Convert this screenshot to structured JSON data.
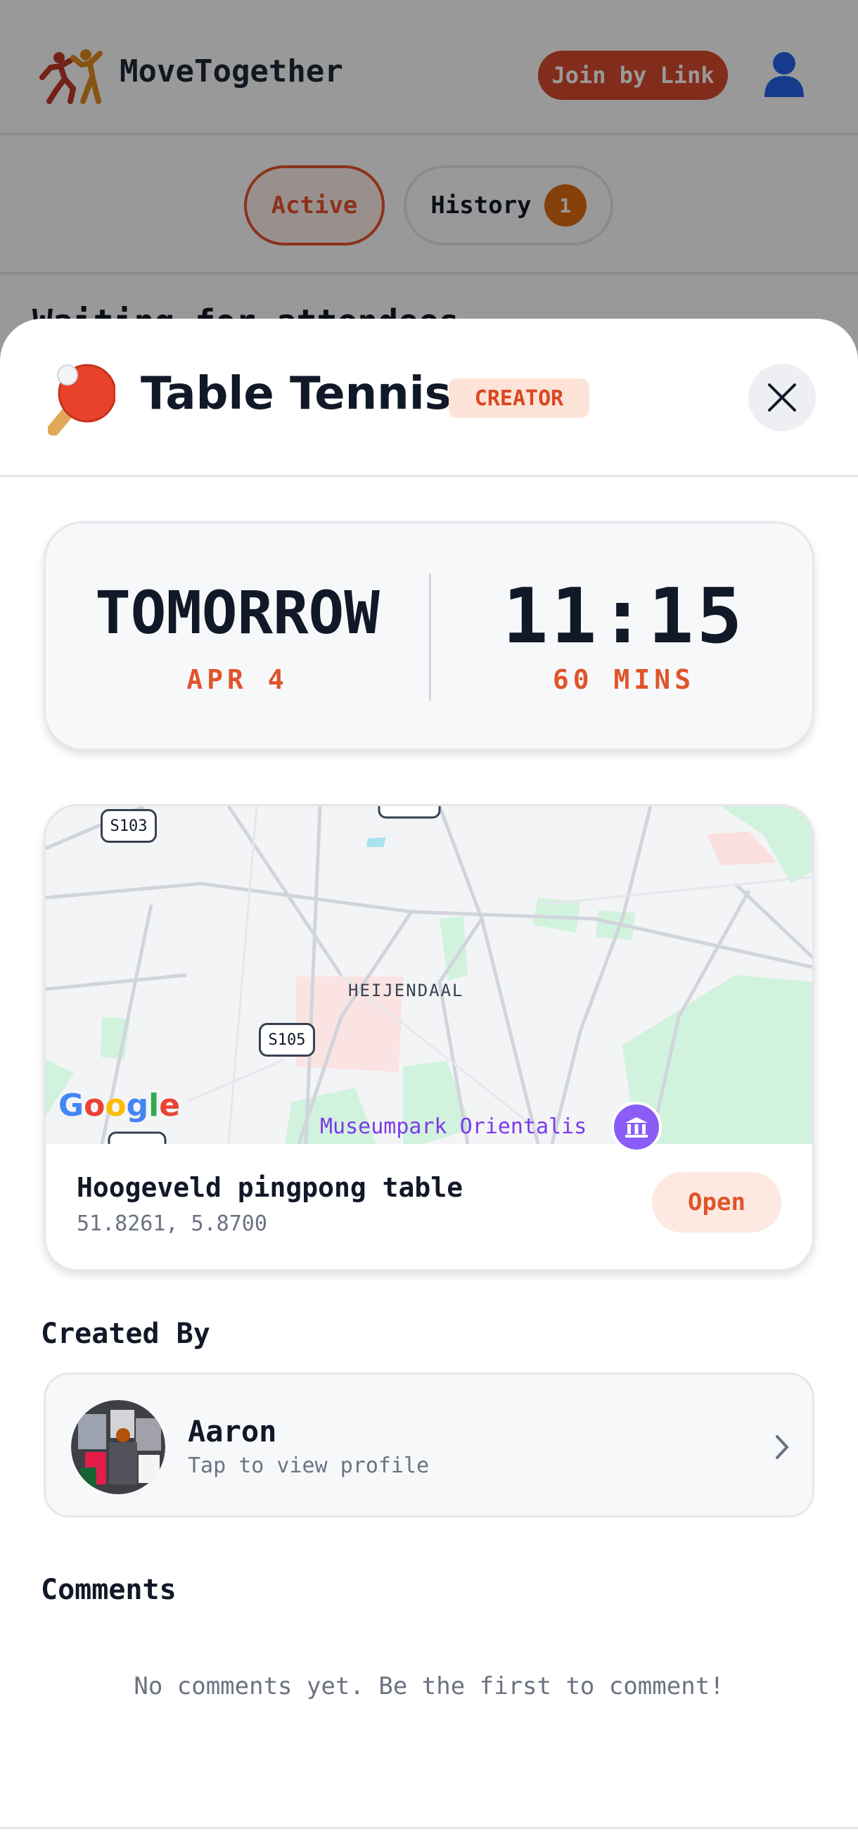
{
  "app": {
    "title": "MoveTogether",
    "join_label": "Join by Link",
    "tabs": [
      {
        "label": "Active"
      },
      {
        "label": "History",
        "badge": "1"
      }
    ],
    "section_heading": "Waiting for attendees"
  },
  "activity": {
    "title": "Table Tennis",
    "role_badge": "CREATOR",
    "day": "TOMORROW",
    "date": "APR 4",
    "time": "11:15",
    "duration": "60 MINS"
  },
  "map": {
    "place_label": "HEIJENDAAL",
    "road_labels": [
      "S103",
      "S105"
    ],
    "google_label": "Google",
    "poi_label": "Museumpark Orientalis"
  },
  "location": {
    "name": "Hoogeveld pingpong table",
    "coords": "51.8261, 5.8700",
    "open_label": "Open"
  },
  "creator": {
    "section_title": "Created By",
    "name": "Aaron",
    "subtitle": "Tap to view profile"
  },
  "comments": {
    "section_title": "Comments",
    "empty_text": "No comments yet. Be the first to comment!"
  },
  "colors": {
    "accent": "#e0542a",
    "badge_bg": "#fde3d8",
    "overlay": "rgba(0,0,0,0.40)"
  },
  "icons": [
    "movetogether-logo-icon",
    "user-icon",
    "table-tennis-icon",
    "close-icon",
    "museum-icon",
    "chevron-right-icon"
  ]
}
